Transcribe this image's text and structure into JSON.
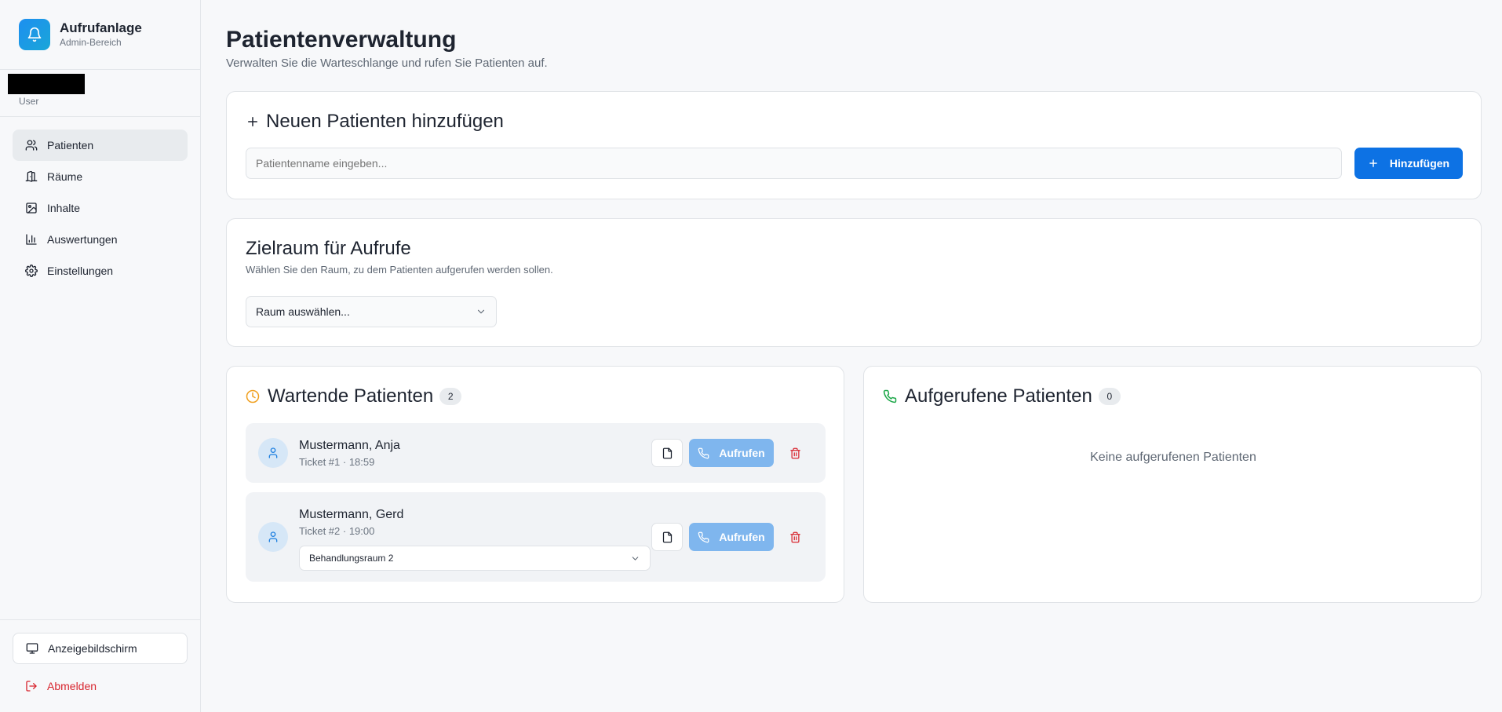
{
  "app": {
    "title": "Aufrufanlage",
    "subtitle": "Admin-Bereich"
  },
  "user": {
    "role": "User"
  },
  "sidebar": {
    "items": [
      {
        "label": "Patienten",
        "icon": "users-icon",
        "active": true
      },
      {
        "label": "Räume",
        "icon": "door-icon"
      },
      {
        "label": "Inhalte",
        "icon": "image-icon"
      },
      {
        "label": "Auswertungen",
        "icon": "bar-chart-icon"
      },
      {
        "label": "Einstellungen",
        "icon": "gear-icon"
      }
    ],
    "display_button": "Anzeigebildschirm",
    "logout": "Abmelden"
  },
  "page": {
    "title": "Patientenverwaltung",
    "subtitle": "Verwalten Sie die Warteschlange und rufen Sie Patienten auf."
  },
  "add_patient": {
    "title": "Neuen Patienten hinzufügen",
    "placeholder": "Patientenname eingeben...",
    "button": "Hinzufügen"
  },
  "target_room": {
    "title": "Zielraum für Aufrufe",
    "description": "Wählen Sie den Raum, zu dem Patienten aufgerufen werden sollen.",
    "select_placeholder": "Raum auswählen..."
  },
  "waiting": {
    "title": "Wartende Patienten",
    "count": "2",
    "patients": [
      {
        "name": "Mustermann, Anja",
        "meta": "Ticket #1 · 18:59",
        "call_label": "Aufrufen"
      },
      {
        "name": "Mustermann, Gerd",
        "meta": "Ticket #2 · 19:00",
        "room": "Behandlungsraum 2",
        "call_label": "Aufrufen"
      }
    ]
  },
  "called": {
    "title": "Aufgerufene Patienten",
    "count": "0",
    "empty": "Keine aufgerufenen Patienten"
  },
  "colors": {
    "primary": "#0d72e4",
    "call_disabled": "#7fb6ee",
    "danger": "#d8262f",
    "waiting_icon": "#f0a020",
    "called_icon": "#1ea84a"
  }
}
